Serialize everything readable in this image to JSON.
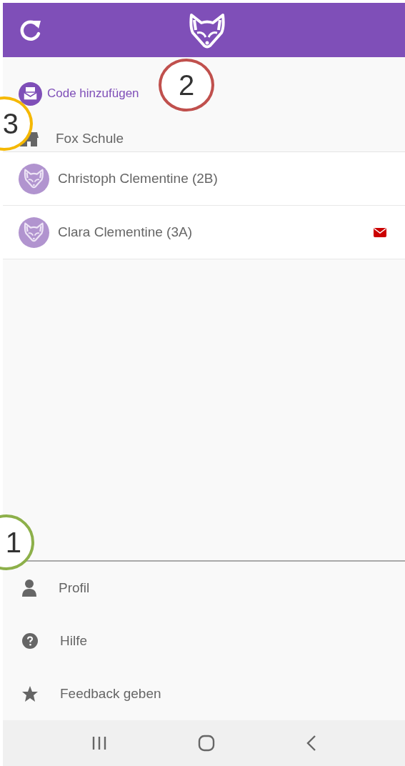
{
  "add_code": {
    "label": "Code hinzufügen"
  },
  "school": {
    "name": "Fox Schule"
  },
  "children": [
    {
      "name": "Christoph Clementine (2B)",
      "unread": false
    },
    {
      "name": "Clara Clementine (3A)",
      "unread": true
    }
  ],
  "menu": [
    {
      "kind": "profile",
      "label": "Profil"
    },
    {
      "kind": "help",
      "label": "Hilfe"
    },
    {
      "kind": "feedback",
      "label": "Feedback geben"
    }
  ],
  "callouts": [
    {
      "number": "2",
      "color": "#c0504d"
    },
    {
      "number": "3",
      "color": "#f5b800"
    },
    {
      "number": "1",
      "color": "#8db04a"
    }
  ]
}
